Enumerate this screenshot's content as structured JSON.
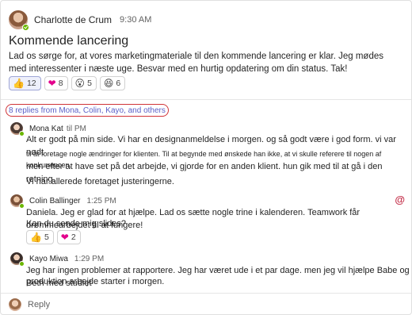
{
  "post": {
    "author": "Charlotte de Crum",
    "time": "9:30 AM",
    "title": "Kommende lancering",
    "body": "Lad os sørge for, at vores marketingmateriale til den kommende lancering er klar. Jeg mødes med interessenter i næste uge. Besvar med en hurtig opdatering om din status. Tak!",
    "reactions": [
      {
        "icon": "thumbs-up-icon",
        "emoji": "👍",
        "count": "12",
        "mine": true
      },
      {
        "icon": "heart-icon",
        "emoji": "❤",
        "count": "8",
        "mine": false
      },
      {
        "icon": "surprised-face-icon",
        "emoji": "😮",
        "count": "5",
        "mine": false
      },
      {
        "icon": "laughing-face-icon",
        "emoji": "😆",
        "count": "6",
        "mine": false
      }
    ]
  },
  "thread": {
    "replies_link": "8 replies from Mona, Colin, Kayo, and others"
  },
  "replies": [
    {
      "author": "Mona Kat",
      "time": "til PM",
      "lines": [
        "Alt er godt på min side. Vi har en designanmeldelse i morgen. og så godt være i god form. vi var nødt",
        "til at foretage nogle ændringer for klienten. Til at begynde med ønskede han ikke, at vi skulle referere til nogen af konkurrencen.",
        "men efter at have set på det arbejde, vi gjorde for en anden klient. hun gik med til at gå i den retning.",
        "Vi har allerede foretaget justeringerne."
      ]
    },
    {
      "author": "Colin Ballinger",
      "time": "1:25 PM",
      "lines": [
        "Daniela. Jeg er glad for at hjælpe. Lad os sætte nogle trine i kalenderen. Teamwork får drømmearbejdet til at fungere!",
        "Kan du sende mig slides?"
      ],
      "reactions": [
        {
          "icon": "thumbs-up-icon",
          "emoji": "👍",
          "count": "5",
          "mine": false
        },
        {
          "icon": "heart-icon",
          "emoji": "❤",
          "count": "2",
          "mine": false
        }
      ],
      "mention_symbol": "@"
    },
    {
      "author": "Kayo Miwa",
      "time": "1:29 PM",
      "lines": [
        "Jeg har ingen problemer at rapportere. Jeg har været ude i et par dage. men jeg vil hjælpe Babe og Beth med studiet",
        "produktion arbejde starter i morgen."
      ]
    }
  ],
  "reply_box": {
    "placeholder": "Reply"
  },
  "colors": {
    "accent": "#5b5fc7",
    "highlight_border": "#d13438",
    "mention": "#c4314b",
    "presence": "#6bb700",
    "heart": "#e3008c"
  }
}
